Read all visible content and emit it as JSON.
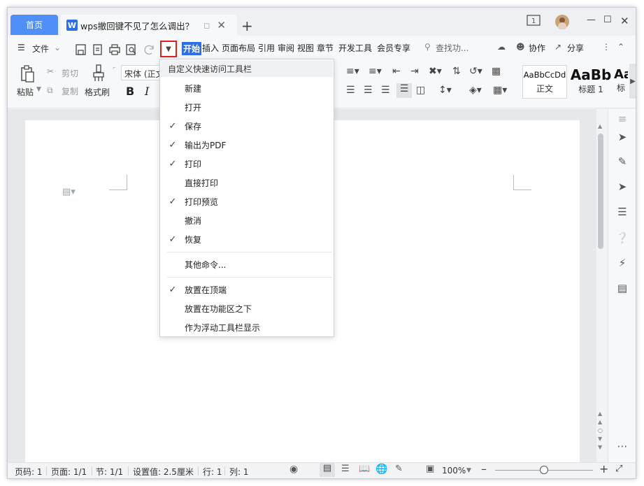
{
  "titlebar": {
    "home_tab": "首页",
    "doc_tab_title": "wps撤回键不见了怎么调出？",
    "doc_icon": "W",
    "add_tab": "+"
  },
  "toolbar": {
    "file_menu": "文件",
    "tabs": [
      "开始",
      "插入",
      "页面布局",
      "引用",
      "审阅",
      "视图",
      "章节",
      "开发工具",
      "会员专享"
    ],
    "search_placeholder": "查找功...",
    "collab": "协作",
    "share": "分享"
  },
  "ribbon": {
    "paste": "粘贴",
    "cut": "剪切",
    "copy": "复制",
    "format_painter": "格式刷",
    "font_name": "宋体 (正文",
    "bold": "B",
    "italic": "I",
    "styles": [
      {
        "sample": "AaBbCcDd",
        "name": "正文"
      },
      {
        "sample": "AaBb",
        "name": "标题 1"
      },
      {
        "sample": "Aa",
        "name": "标"
      }
    ]
  },
  "dropdown": {
    "header": "自定义快速访问工具栏",
    "group1": [
      {
        "label": "新建",
        "checked": false
      },
      {
        "label": "打开",
        "checked": false
      },
      {
        "label": "保存",
        "checked": true
      },
      {
        "label": "输出为PDF",
        "checked": true
      },
      {
        "label": "打印",
        "checked": true
      },
      {
        "label": "直接打印",
        "checked": false
      },
      {
        "label": "打印预览",
        "checked": true
      },
      {
        "label": "撤消",
        "checked": false
      },
      {
        "label": "恢复",
        "checked": true
      }
    ],
    "other_commands": "其他命令...",
    "group2": [
      {
        "label": "放置在顶端",
        "checked": true
      },
      {
        "label": "放置在功能区之下",
        "checked": false
      },
      {
        "label": "作为浮动工具栏显示",
        "checked": false
      }
    ]
  },
  "statusbar": {
    "page_no": "页码: 1",
    "pages": "页面: 1/1",
    "section": "节: 1/1",
    "setting": "设置值: 2.5厘米",
    "row": "行: 1",
    "col": "列: 1",
    "zoom": "100%",
    "zoom_level_fraction": 0.5
  },
  "colors": {
    "accent": "#2e6ee6",
    "home_tab": "#4f8ff7",
    "highlight_border": "#e02020"
  }
}
